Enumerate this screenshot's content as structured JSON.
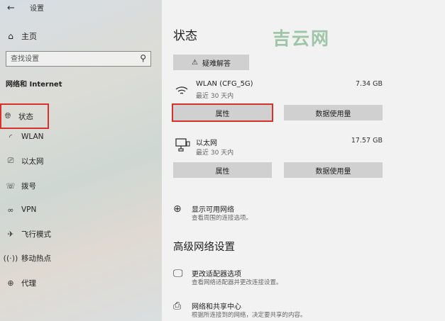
{
  "window": {
    "title": "设置"
  },
  "sidebar": {
    "home_label": "主页",
    "search_placeholder": "查找设置",
    "section_title": "网络和 Internet",
    "items": [
      {
        "label": "状态",
        "icon": "globe-icon",
        "selected": true
      },
      {
        "label": "WLAN",
        "icon": "wifi-icon"
      },
      {
        "label": "以太网",
        "icon": "ethernet-icon"
      },
      {
        "label": "拨号",
        "icon": "dialup-icon"
      },
      {
        "label": "VPN",
        "icon": "vpn-icon"
      },
      {
        "label": "飞行模式",
        "icon": "airplane-icon"
      },
      {
        "label": "移动热点",
        "icon": "hotspot-icon"
      },
      {
        "label": "代理",
        "icon": "proxy-globe-icon"
      }
    ]
  },
  "main": {
    "title": "状态",
    "watermark": "吉云网",
    "troubleshoot_label": "疑难解答",
    "networks": [
      {
        "name": "WLAN (CFG_5G)",
        "period": "最近 30 天内",
        "usage": "7.34 GB",
        "properties_label": "属性",
        "data_usage_label": "数据使用量",
        "icon": "wifi-icon"
      },
      {
        "name": "以太网",
        "period": "最近 30 天内",
        "usage": "17.57 GB",
        "properties_label": "属性",
        "data_usage_label": "数据使用量",
        "icon": "ethernet-icon"
      }
    ],
    "show_networks": {
      "title": "显示可用网络",
      "subtitle": "查看周围的连接选项。"
    },
    "advanced_title": "高级网络设置",
    "advanced_items": [
      {
        "title": "更改适配器选项",
        "subtitle": "查看网络适配器并更改连接设置。"
      },
      {
        "title": "网络和共享中心",
        "subtitle": "根据所连接到的网络，决定要共享的内容。"
      }
    ]
  },
  "colors": {
    "highlight": "#d9302c",
    "button_bg": "#d0d0d0",
    "watermark": "#9fc5a8"
  }
}
